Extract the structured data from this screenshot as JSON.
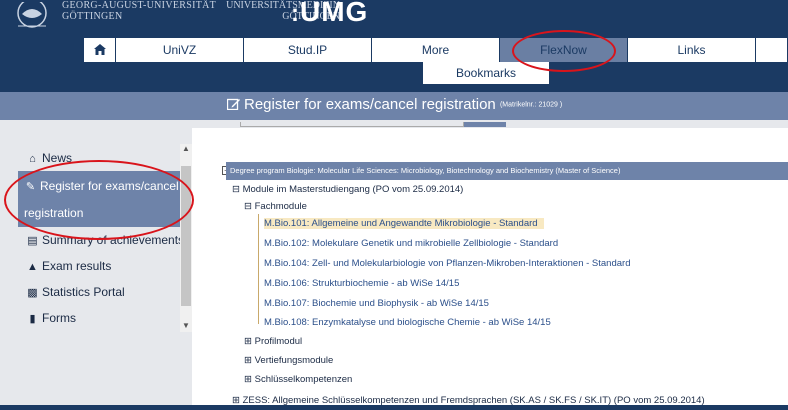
{
  "header": {
    "uni_name_line1": "GEORG-AUGUST-UNIVERSITÄT",
    "uni_name_line2": "GÖTTINGEN",
    "umg_line1": "UNIVERSITÄTSMEDIZIN",
    "umg_line2": "GÖTTINGEN",
    "umg_big": "UMG"
  },
  "nav": {
    "items": [
      "UniVZ",
      "Stud.IP",
      "More",
      "FlexNow",
      "Links"
    ],
    "bookmarks": "Bookmarks",
    "active": "FlexNow"
  },
  "titlebar": {
    "title": "Register for exams/cancel registration",
    "matrikel": "(Matrikelnr.: 21029 )"
  },
  "sidebar": {
    "items": [
      {
        "icon": "home-icon",
        "label": "News"
      },
      {
        "icon": "edit-icon",
        "label": "Register for exams/cancel registration"
      },
      {
        "icon": "list-icon",
        "label": "Summary of achievements"
      },
      {
        "icon": "graduation-cap-icon",
        "label": "Exam results"
      },
      {
        "icon": "bar-chart-icon",
        "label": "Statistics Portal"
      },
      {
        "icon": "file-icon",
        "label": "Forms"
      }
    ]
  },
  "tree": {
    "degree": "Degree program Biologie: Molecular Life Sciences: Microbiology, Biotechnology and Biochemistry (Master of Science)",
    "module": "Module im Masterstudiengang (PO vom 25.09.2014)",
    "fachmodule": "Fachmodule",
    "leaves": [
      "M.Bio.101: Allgemeine und Angewandte Mikrobiologie - Standard",
      "M.Bio.102: Molekulare Genetik und mikrobielle Zellbiologie - Standard",
      "M.Bio.104: Zell- und Molekularbiologie von Pflanzen-Mikroben-Interaktionen - Standard",
      "M.Bio.106: Strukturbiochemie - ab WiSe 14/15",
      "M.Bio.107: Biochemie und Biophysik - ab WiSe 14/15",
      "M.Bio.108: Enzymkatalyse und biologische Chemie - ab WiSe 14/15"
    ],
    "collapsed": [
      "Profilmodul",
      "Vertiefungsmodule",
      "Schlüsselkompetenzen"
    ],
    "zess": "ZESS: Allgemeine Schlüsselkompetenzen und Fremdsprachen (SK.AS / SK.FS / SK.IT) (PO vom 25.09.2014)",
    "expanded_symbol": "⊟",
    "collapsed_symbol": "⊞"
  },
  "colors": {
    "navy": "#1b3a63",
    "accent": "#6e83a9",
    "highlight": "#f8e9c2",
    "annotation": "#d9141b"
  }
}
